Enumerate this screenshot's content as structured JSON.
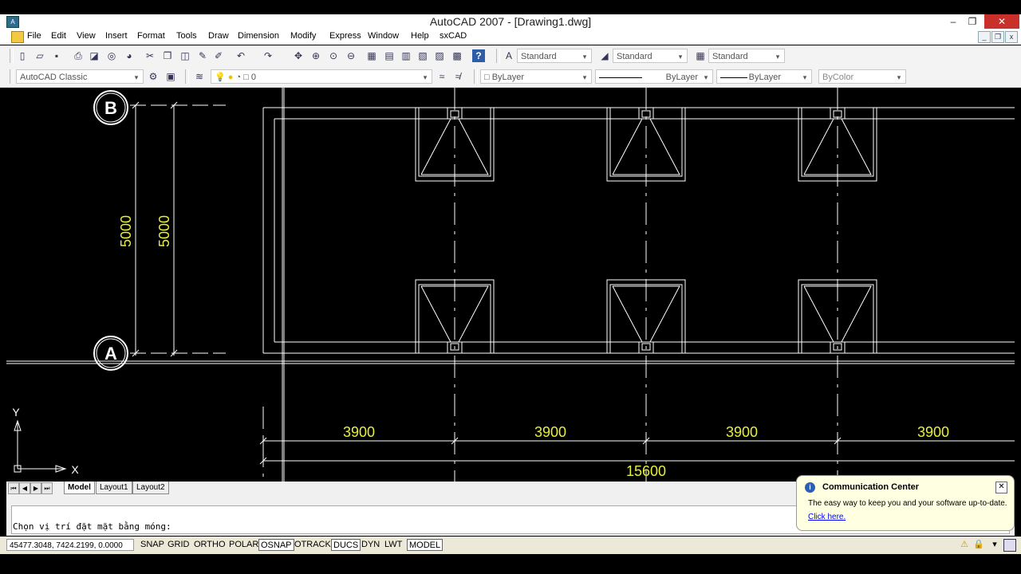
{
  "window": {
    "title": "AutoCAD 2007 - [Drawing1.dwg]",
    "app_icon": "autocad-icon",
    "minimize": "–",
    "restore": "❐",
    "close": "✕"
  },
  "menu": {
    "items": [
      "File",
      "Edit",
      "View",
      "Insert",
      "Format",
      "Tools",
      "Draw",
      "Dimension",
      "Modify",
      "Express",
      "Window",
      "Help",
      "sxCAD"
    ]
  },
  "toolbar1": {
    "text_style": "Standard",
    "dim_style": "Standard",
    "table_style": "Standard"
  },
  "toolbar2": {
    "workspace": "AutoCAD Classic",
    "layer": "0",
    "color": "ByLayer",
    "linetype": "ByLayer",
    "lineweight": "ByLayer",
    "plotstyle": "ByColor"
  },
  "drawing": {
    "grid_bubbles": [
      "B",
      "A"
    ],
    "vertical_dims": [
      "5000",
      "5000"
    ],
    "bay_dims": [
      "3900",
      "3900",
      "3900",
      "3900"
    ],
    "total_dim": "15600",
    "ucs_x": "X",
    "ucs_y": "Y",
    "colors": {
      "dim_text": "#e8f03a",
      "lines": "#ffffff"
    }
  },
  "tabs": {
    "model": "Model",
    "layout1": "Layout1",
    "layout2": "Layout2"
  },
  "command": {
    "prompt": "Chọn vị trí đặt mặt bằng móng:"
  },
  "status": {
    "coords": "45477.3048, 7424.2199, 0.0000",
    "buttons": [
      "SNAP",
      "GRID",
      "ORTHO",
      "POLAR",
      "OSNAP",
      "OTRACK",
      "DUCS",
      "DYN",
      "LWT",
      "MODEL"
    ]
  },
  "popup": {
    "title": "Communication Center",
    "text": "The easy way to keep you and your software up-to-date.",
    "link": "Click here."
  }
}
